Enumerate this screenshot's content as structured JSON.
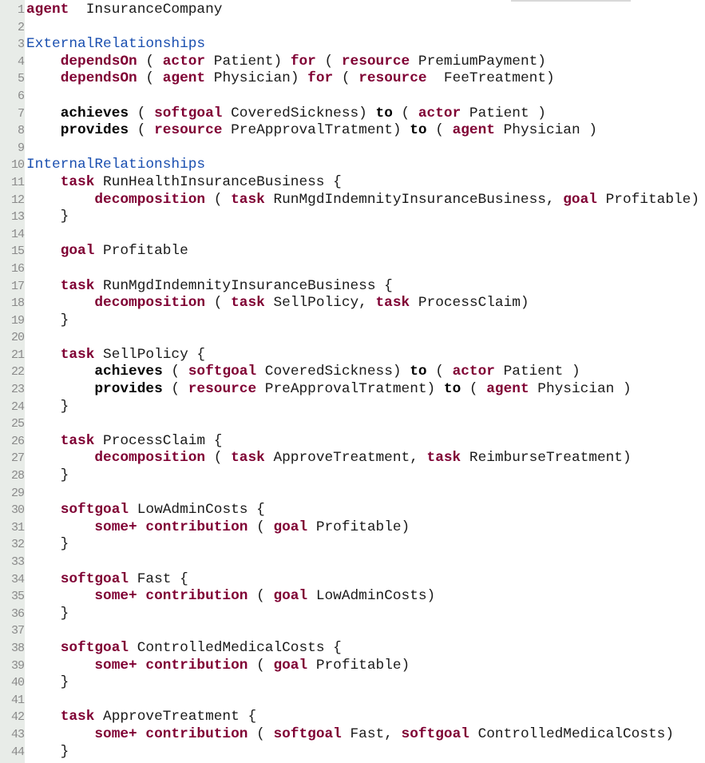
{
  "editor": {
    "colors": {
      "keyword": "#7f0033",
      "section": "#1a4fb0",
      "gutter": "#e8ece8",
      "line_number": "#8a8a8a"
    },
    "lines": [
      [
        [
          "k",
          "agent"
        ],
        [
          "",
          "  InsuranceCompany"
        ]
      ],
      [],
      [
        [
          "s",
          "ExternalRelationships"
        ]
      ],
      [
        [
          "",
          "    "
        ],
        [
          "k",
          "dependsOn"
        ],
        [
          "",
          " ( "
        ],
        [
          "k",
          "actor"
        ],
        [
          "",
          " Patient) "
        ],
        [
          "k",
          "for"
        ],
        [
          "",
          " ( "
        ],
        [
          "k",
          "resource"
        ],
        [
          "",
          " PremiumPayment)"
        ]
      ],
      [
        [
          "",
          "    "
        ],
        [
          "k",
          "dependsOn"
        ],
        [
          "",
          " ( "
        ],
        [
          "k",
          "agent"
        ],
        [
          "",
          " Physician) "
        ],
        [
          "k",
          "for"
        ],
        [
          "",
          " ( "
        ],
        [
          "k",
          "resource"
        ],
        [
          "",
          "  FeeTreatment)"
        ]
      ],
      [],
      [
        [
          "",
          "    "
        ],
        [
          "b",
          "achieves"
        ],
        [
          "",
          " ( "
        ],
        [
          "k",
          "softgoal"
        ],
        [
          "",
          " CoveredSickness) "
        ],
        [
          "b",
          "to"
        ],
        [
          "",
          " ( "
        ],
        [
          "k",
          "actor"
        ],
        [
          "",
          " Patient )"
        ]
      ],
      [
        [
          "",
          "    "
        ],
        [
          "b",
          "provides"
        ],
        [
          "",
          " ( "
        ],
        [
          "k",
          "resource"
        ],
        [
          "",
          " PreApprovalTratment) "
        ],
        [
          "b",
          "to"
        ],
        [
          "",
          " ( "
        ],
        [
          "k",
          "agent"
        ],
        [
          "",
          " Physician )"
        ]
      ],
      [],
      [
        [
          "s",
          "InternalRelationships"
        ]
      ],
      [
        [
          "",
          "    "
        ],
        [
          "k",
          "task"
        ],
        [
          "",
          " RunHealthInsuranceBusiness {"
        ]
      ],
      [
        [
          "",
          "        "
        ],
        [
          "k",
          "decomposition"
        ],
        [
          "",
          " ( "
        ],
        [
          "k",
          "task"
        ],
        [
          "",
          " RunMgdIndemnityInsuranceBusiness, "
        ],
        [
          "k",
          "goal"
        ],
        [
          "",
          " Profitable)"
        ]
      ],
      [
        [
          "",
          "    }"
        ]
      ],
      [],
      [
        [
          "",
          "    "
        ],
        [
          "k",
          "goal"
        ],
        [
          "",
          " Profitable"
        ]
      ],
      [],
      [
        [
          "",
          "    "
        ],
        [
          "k",
          "task"
        ],
        [
          "",
          " RunMgdIndemnityInsuranceBusiness {"
        ]
      ],
      [
        [
          "",
          "        "
        ],
        [
          "k",
          "decomposition"
        ],
        [
          "",
          " ( "
        ],
        [
          "k",
          "task"
        ],
        [
          "",
          " SellPolicy, "
        ],
        [
          "k",
          "task"
        ],
        [
          "",
          " ProcessClaim)"
        ]
      ],
      [
        [
          "",
          "    }"
        ]
      ],
      [],
      [
        [
          "",
          "    "
        ],
        [
          "k",
          "task"
        ],
        [
          "",
          " SellPolicy {"
        ]
      ],
      [
        [
          "",
          "        "
        ],
        [
          "b",
          "achieves"
        ],
        [
          "",
          " ( "
        ],
        [
          "k",
          "softgoal"
        ],
        [
          "",
          " CoveredSickness) "
        ],
        [
          "b",
          "to"
        ],
        [
          "",
          " ( "
        ],
        [
          "k",
          "actor"
        ],
        [
          "",
          " Patient )"
        ]
      ],
      [
        [
          "",
          "        "
        ],
        [
          "b",
          "provides"
        ],
        [
          "",
          " ( "
        ],
        [
          "k",
          "resource"
        ],
        [
          "",
          " PreApprovalTratment) "
        ],
        [
          "b",
          "to"
        ],
        [
          "",
          " ( "
        ],
        [
          "k",
          "agent"
        ],
        [
          "",
          " Physician )"
        ]
      ],
      [
        [
          "",
          "    }"
        ]
      ],
      [],
      [
        [
          "",
          "    "
        ],
        [
          "k",
          "task"
        ],
        [
          "",
          " ProcessClaim {"
        ]
      ],
      [
        [
          "",
          "        "
        ],
        [
          "k",
          "decomposition"
        ],
        [
          "",
          " ( "
        ],
        [
          "k",
          "task"
        ],
        [
          "",
          " ApproveTreatment, "
        ],
        [
          "k",
          "task"
        ],
        [
          "",
          " ReimburseTreatment)"
        ]
      ],
      [
        [
          "",
          "    }"
        ]
      ],
      [],
      [
        [
          "",
          "    "
        ],
        [
          "k",
          "softgoal"
        ],
        [
          "",
          " LowAdminCosts {"
        ]
      ],
      [
        [
          "",
          "        "
        ],
        [
          "k",
          "some+ contribution"
        ],
        [
          "",
          " ( "
        ],
        [
          "k",
          "goal"
        ],
        [
          "",
          " Profitable)"
        ]
      ],
      [
        [
          "",
          "    }"
        ]
      ],
      [],
      [
        [
          "",
          "    "
        ],
        [
          "k",
          "softgoal"
        ],
        [
          "",
          " Fast {"
        ]
      ],
      [
        [
          "",
          "        "
        ],
        [
          "k",
          "some+ contribution"
        ],
        [
          "",
          " ( "
        ],
        [
          "k",
          "goal"
        ],
        [
          "",
          " LowAdminCosts)"
        ]
      ],
      [
        [
          "",
          "    }"
        ]
      ],
      [],
      [
        [
          "",
          "    "
        ],
        [
          "k",
          "softgoal"
        ],
        [
          "",
          " ControlledMedicalCosts {"
        ]
      ],
      [
        [
          "",
          "        "
        ],
        [
          "k",
          "some+ contribution"
        ],
        [
          "",
          " ( "
        ],
        [
          "k",
          "goal"
        ],
        [
          "",
          " Profitable)"
        ]
      ],
      [
        [
          "",
          "    }"
        ]
      ],
      [],
      [
        [
          "",
          "    "
        ],
        [
          "k",
          "task"
        ],
        [
          "",
          " ApproveTreatment {"
        ]
      ],
      [
        [
          "",
          "        "
        ],
        [
          "k",
          "some+ contribution"
        ],
        [
          "",
          " ( "
        ],
        [
          "k",
          "softgoal"
        ],
        [
          "",
          " Fast, "
        ],
        [
          "k",
          "softgoal"
        ],
        [
          "",
          " ControlledMedicalCosts)"
        ]
      ],
      [
        [
          "",
          "    }"
        ]
      ]
    ]
  }
}
